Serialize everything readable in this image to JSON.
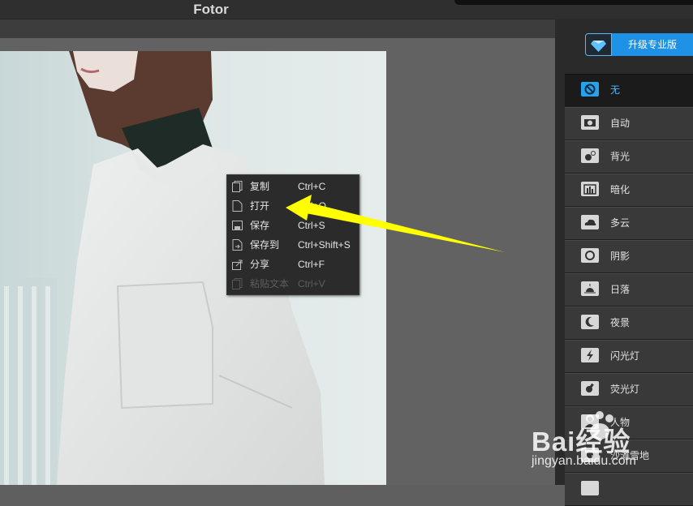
{
  "app": {
    "title": "Fotor"
  },
  "upgrade": {
    "label": "升级专业版",
    "icon": "diamond-icon"
  },
  "context_menu": {
    "items": [
      {
        "label": "复制",
        "shortcut": "Ctrl+C",
        "icon": "copy-icon",
        "disabled": false
      },
      {
        "label": "打开",
        "shortcut": "Ctrl+O",
        "icon": "file-icon",
        "disabled": false
      },
      {
        "label": "保存",
        "shortcut": "Ctrl+S",
        "icon": "save-icon",
        "disabled": false
      },
      {
        "label": "保存到",
        "shortcut": "Ctrl+Shift+S",
        "icon": "save-to-icon",
        "disabled": false
      },
      {
        "label": "分享",
        "shortcut": "Ctrl+F",
        "icon": "share-icon",
        "disabled": false
      },
      {
        "label": "粘贴文本",
        "shortcut": "Ctrl+V",
        "icon": "paste-icon",
        "disabled": true
      }
    ]
  },
  "scenes": {
    "items": [
      {
        "label": "无",
        "icon": "none-icon",
        "active": true
      },
      {
        "label": "自动",
        "icon": "camera-icon"
      },
      {
        "label": "背光",
        "icon": "backlight-icon"
      },
      {
        "label": "暗化",
        "icon": "darken-icon"
      },
      {
        "label": "多云",
        "icon": "cloud-icon"
      },
      {
        "label": "阴影",
        "icon": "shadow-icon"
      },
      {
        "label": "日落",
        "icon": "sunset-icon"
      },
      {
        "label": "夜景",
        "icon": "moon-icon"
      },
      {
        "label": "闪光灯",
        "icon": "flash-icon"
      },
      {
        "label": "荧光灯",
        "icon": "fluorescent-icon"
      },
      {
        "label": "人物",
        "icon": "portrait-icon"
      },
      {
        "label": "沙滩雪地",
        "icon": "beach-snow-icon"
      }
    ]
  },
  "watermark": {
    "brand": "Bai经验",
    "url": "jingyan.baidu.com"
  },
  "colors": {
    "accent": "#1e92e6",
    "arrow": "#ffff00",
    "panel": "#2a2a2a"
  }
}
